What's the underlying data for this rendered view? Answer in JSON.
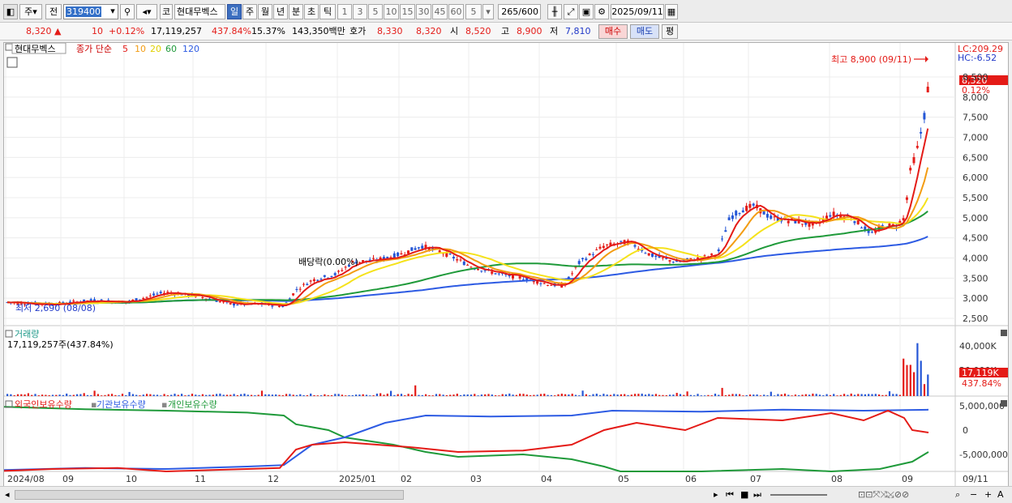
{
  "toolbar": {
    "market_label": "주",
    "prev_label": "전",
    "code": "319400",
    "coin_label": "코",
    "stock_name": "현대무벡스",
    "periods": [
      "일",
      "주",
      "월",
      "년",
      "분",
      "초",
      "틱"
    ],
    "active_period": "일",
    "intervals": [
      "1",
      "3",
      "5",
      "10",
      "15",
      "30",
      "45",
      "60"
    ],
    "interval_value": "5",
    "count": "265",
    "count_total": "/600",
    "date": "2025/09/11"
  },
  "infobar": {
    "price": "8,320",
    "arrow": "▲",
    "change": "10",
    "change_pct": "+0.12%",
    "volume": "17,119,257",
    "volume_ratio": "437.84%",
    "turnover": "15.37%",
    "amount": "143,350백만",
    "ask_label": "호가",
    "ask": "8,330",
    "bid": "8,320",
    "open_label": "시",
    "open": "8,520",
    "high_label": "고",
    "high": "8,900",
    "low_label": "저",
    "low": "7,810",
    "buy_label": "매수",
    "sell_label": "매도",
    "avg_label": "평"
  },
  "price_pane": {
    "title": "현대무벡스",
    "ma_label": "종가 단순",
    "ma_periods": [
      "5",
      "10",
      "20",
      "60",
      "120"
    ],
    "lc_label": "LC:209.29",
    "hc_label": "HC:-6.52",
    "high_marker": "최고 8,900 (09/11)",
    "low_marker": "최저 2,690 (08/08)",
    "dividend_label": "배당락(0.00%)",
    "current_price_tag": "8,320",
    "current_pct_tag": "0.12%",
    "y_ticks": [
      "8,500",
      "8,000",
      "7,500",
      "7,000",
      "6,500",
      "6,000",
      "5,500",
      "5,000",
      "4,500",
      "4,000",
      "3,500",
      "3,000",
      "2,500"
    ]
  },
  "volume_pane": {
    "title": "거래량",
    "value_text": "17,119,257주(437.84%)",
    "y_ticks": [
      "40,000K",
      "20,000K"
    ],
    "current_tag": "17,119K",
    "current_pct": "437.84%"
  },
  "holding_pane": {
    "series": [
      "외국인보유수량",
      "기관보유수량",
      "개인보유수량"
    ],
    "y_ticks": [
      "5,000,000",
      "0",
      "-5,000,000"
    ]
  },
  "x_axis": {
    "labels": [
      "2024/08",
      "09",
      "10",
      "11",
      "12",
      "2025/01",
      "02",
      "03",
      "04",
      "05",
      "06",
      "07",
      "08",
      "09"
    ],
    "last_label": "09/11"
  },
  "colors": {
    "up": "#e41b17",
    "down": "#2456d6",
    "ma5": "#e41b17",
    "ma10": "#f39c12",
    "ma20": "#f5e21b",
    "ma60": "#1f9a3a",
    "ma120": "#2d5be3"
  },
  "chart_data": {
    "type": "line",
    "title": "현대무벡스",
    "series": [
      {
        "name": "종가",
        "x": [
          "2024/08",
          "2024/09",
          "2024/10",
          "2024/11",
          "2024/12",
          "2025/01",
          "2025/02",
          "2025/03",
          "2025/04",
          "2025/05",
          "2025/06",
          "2025/07",
          "2025/08",
          "2025/09/11"
        ],
        "values": [
          2900,
          3000,
          3100,
          2950,
          2800,
          3700,
          4200,
          3600,
          3400,
          4400,
          3900,
          5100,
          4900,
          8320
        ]
      },
      {
        "name": "120",
        "values": [
          2950,
          2950,
          2960,
          2980,
          3000,
          3150,
          3350,
          3500,
          3550,
          3700,
          3850,
          4100,
          4250,
          4550
        ]
      }
    ],
    "ylim": [
      2500,
      8900
    ]
  }
}
